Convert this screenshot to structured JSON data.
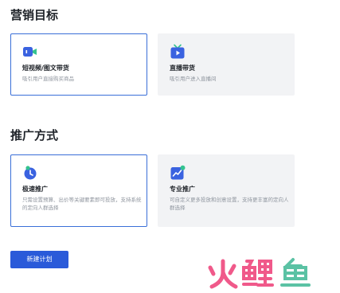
{
  "marketing_goal": {
    "title": "营销目标",
    "options": [
      {
        "title": "短视频/图文带货",
        "desc": "吸引用户直接购买商品",
        "icon": "video-camera-icon",
        "selected": true
      },
      {
        "title": "直播带货",
        "desc": "吸引用户进入直播间",
        "icon": "tv-live-icon",
        "selected": false
      }
    ]
  },
  "promotion_method": {
    "title": "推广方式",
    "options": [
      {
        "title": "极速推广",
        "desc": "只需设置预算、出价等关键要素即可投放，支持系统的定向人群选择",
        "icon": "rocket-icon",
        "selected": true
      },
      {
        "title": "专业推广",
        "desc": "可自定义更多投放和创意设置，支持更丰富的定向人群选择",
        "icon": "trend-chart-icon",
        "selected": false
      }
    ]
  },
  "actions": {
    "new_plan_label": "新建计划"
  },
  "watermark": {
    "text": "火鲤鱼"
  },
  "colors": {
    "accent": "#2a5ad9",
    "selected_border": "#3a6fd8",
    "card_bg": "#f2f3f5",
    "icon_blue": "#3a62e0",
    "icon_green": "#34c38f",
    "watermark_pink": "#f0598a",
    "watermark_green": "#5bc2a4"
  }
}
